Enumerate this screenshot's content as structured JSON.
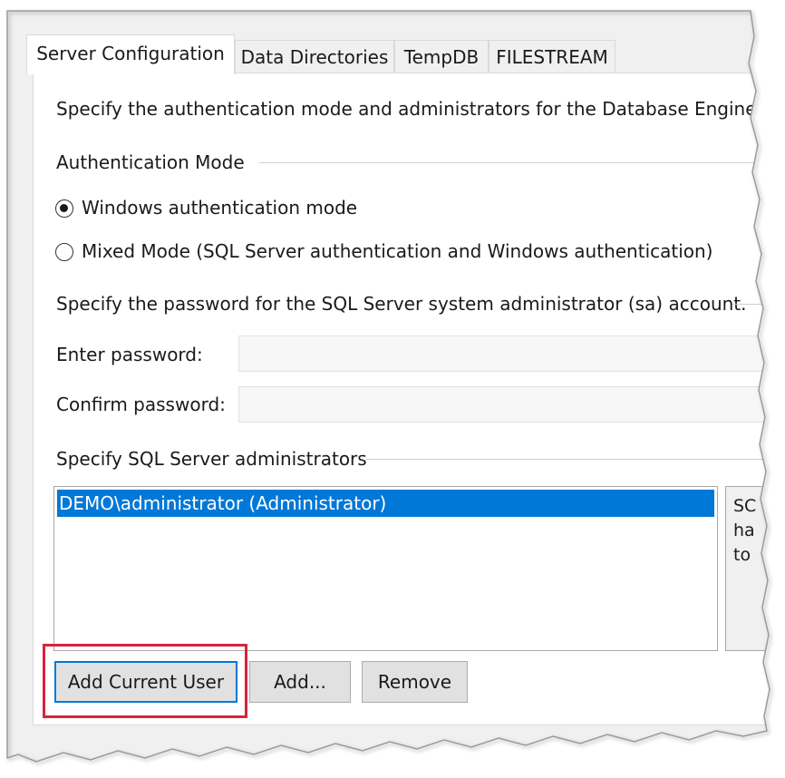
{
  "tabs": [
    {
      "label": "Server Configuration",
      "active": true
    },
    {
      "label": "Data Directories",
      "active": false
    },
    {
      "label": "TempDB",
      "active": false
    },
    {
      "label": "FILESTREAM",
      "active": false
    }
  ],
  "intro": "Specify the authentication mode and administrators for the Database Engine.",
  "auth": {
    "group_label": "Authentication Mode",
    "windows_label": "Windows authentication mode",
    "mixed_label": "Mixed Mode (SQL Server authentication and Windows authentication)",
    "selected": "windows"
  },
  "password": {
    "group_label": "Specify the password for the SQL Server system administrator (sa) account.",
    "enter_label": "Enter password:",
    "confirm_label": "Confirm password:",
    "enter_value": "",
    "confirm_value": ""
  },
  "admins": {
    "group_label": "Specify SQL Server administrators",
    "items": [
      "DEMO\\administrator (Administrator)"
    ],
    "desc_lines": [
      "SC",
      "ha",
      "to"
    ]
  },
  "buttons": {
    "add_current_user": "Add Current User",
    "add": "Add...",
    "remove": "Remove"
  },
  "colors": {
    "selection": "#0078d7",
    "callout": "#d6243b"
  }
}
